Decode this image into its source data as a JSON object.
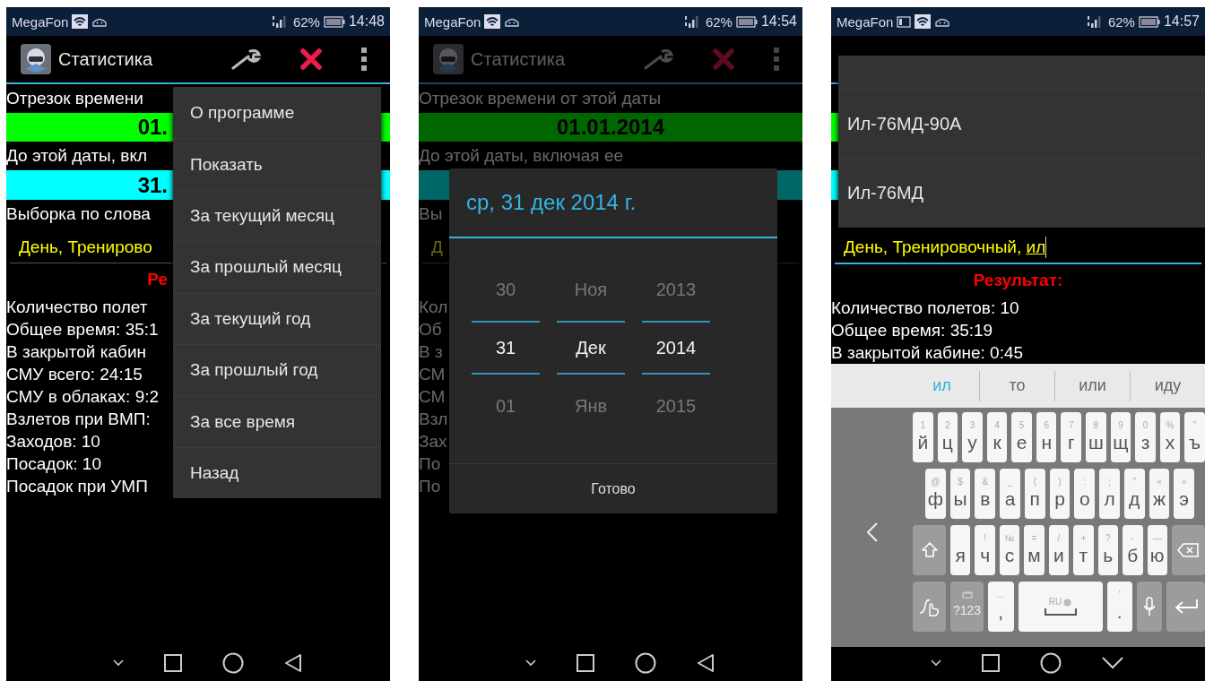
{
  "phones": [
    {
      "kind": "menu",
      "status": {
        "carrier": "MegaFon",
        "screenshot_notice": false,
        "battery": "62%",
        "time": "14:48"
      },
      "app_bar": {
        "title": "Статистика"
      },
      "content": {
        "from_label": "Отрезок времени",
        "from_date": "01.",
        "to_label": "До этой даты, вкл",
        "to_date": "31.",
        "filter_label": "Выборка по слова",
        "filter": {
          "value": "День, Тренирово",
          "focused": false
        },
        "result_title": "Ре",
        "stats": [
          "Количество полет",
          "Общее время: 35:1",
          "В закрытой кабин",
          "СМУ всего: 24:15",
          "СМУ в облаках: 9:2",
          "Взлетов при ВМП:",
          "Заходов: 10",
          "Посадок: 10",
          "Посадок при УМП"
        ]
      },
      "menu": {
        "items": [
          "О программе",
          "Показать",
          "За текущий месяц",
          "За прошлый месяц",
          "За текущий год",
          "За прошлый год",
          "За все время",
          "Назад"
        ]
      }
    },
    {
      "kind": "date_dialog",
      "status": {
        "carrier": "MegaFon",
        "screenshot_notice": false,
        "battery": "62%",
        "time": "14:54"
      },
      "app_bar": {
        "title": "Статистика"
      },
      "content": {
        "from_label": "Отрезок времени от этой даты",
        "from_date": "01.01.2014",
        "to_label": "До этой даты, включая ее",
        "filter_label": "Вы",
        "filter": {
          "value": "Д",
          "focused": false
        },
        "stats": [
          "Кол",
          "Об",
          "В з",
          "СМ",
          "СМ",
          "Взл",
          "Зах",
          "По",
          "По"
        ]
      },
      "dialog": {
        "title": "ср, 31 дек 2014 г.",
        "columns": [
          {
            "items": [
              {
                "text": "30",
                "selected": false
              },
              {
                "text": "31",
                "selected": true
              },
              {
                "text": "01",
                "selected": false
              }
            ]
          },
          {
            "items": [
              {
                "text": "Ноя",
                "selected": false
              },
              {
                "text": "Дек",
                "selected": true
              },
              {
                "text": "Янв",
                "selected": false
              }
            ]
          },
          {
            "items": [
              {
                "text": "2013",
                "selected": false
              },
              {
                "text": "2014",
                "selected": true
              },
              {
                "text": "2015",
                "selected": false
              }
            ]
          }
        ],
        "button": "Готово"
      }
    },
    {
      "kind": "dropdown",
      "status": {
        "carrier": "MegaFon",
        "screenshot_notice": true,
        "battery": "62%",
        "time": "14:57"
      },
      "content": {
        "filter": {
          "value": "День, Тренировочный, ",
          "composing": "ил",
          "focused": true
        },
        "result_title": "Результат:",
        "stats": [
          "Количество полетов: 10",
          "Общее время: 35:19",
          "В закрытой кабине: 0:45"
        ]
      },
      "dropdown": {
        "items": [
          "Ил-76МД-90А",
          "Ил-76МД"
        ]
      },
      "keyboard": {
        "suggestions": [
          {
            "text": "ил",
            "selected": true
          },
          {
            "text": "то",
            "selected": false
          },
          {
            "text": "или",
            "selected": false
          },
          {
            "text": "иду",
            "selected": false
          }
        ],
        "rows": [
          {
            "keys": [
              {
                "kind": "letter",
                "label": "й",
                "hint": "1"
              },
              {
                "kind": "letter",
                "label": "ц",
                "hint": "2"
              },
              {
                "kind": "letter",
                "label": "у",
                "hint": "3"
              },
              {
                "kind": "letter",
                "label": "к",
                "hint": "4"
              },
              {
                "kind": "letter",
                "label": "е",
                "hint": "5"
              },
              {
                "kind": "letter",
                "label": "н",
                "hint": "6"
              },
              {
                "kind": "letter",
                "label": "г",
                "hint": "7"
              },
              {
                "kind": "letter",
                "label": "ш",
                "hint": "8"
              },
              {
                "kind": "letter",
                "label": "щ",
                "hint": "9"
              },
              {
                "kind": "letter",
                "label": "з",
                "hint": "0"
              },
              {
                "kind": "letter",
                "label": "х",
                "hint": "%"
              },
              {
                "kind": "letter",
                "label": "ъ",
                "hint": "\""
              }
            ]
          },
          {
            "keys": [
              {
                "kind": "letter",
                "label": "ф",
                "hint": "@"
              },
              {
                "kind": "letter",
                "label": "ы",
                "hint": "$"
              },
              {
                "kind": "letter",
                "label": "в",
                "hint": "&"
              },
              {
                "kind": "letter",
                "label": "а",
                "hint": "_"
              },
              {
                "kind": "letter",
                "label": "п",
                "hint": "("
              },
              {
                "kind": "letter",
                "label": "р",
                "hint": ")"
              },
              {
                "kind": "letter",
                "label": "о",
                "hint": ":"
              },
              {
                "kind": "letter",
                "label": "л",
                "hint": ";"
              },
              {
                "kind": "letter",
                "label": "д",
                "hint": "\""
              },
              {
                "kind": "letter",
                "label": "ж",
                "hint": "«"
              },
              {
                "kind": "letter",
                "label": "э",
                "hint": "»"
              }
            ]
          },
          {
            "keys": [
              {
                "kind": "shift"
              },
              {
                "kind": "letter",
                "label": "я"
              },
              {
                "kind": "letter",
                "label": "ч",
                "hint": "!"
              },
              {
                "kind": "letter",
                "label": "с",
                "hint": "№"
              },
              {
                "kind": "letter",
                "label": "м",
                "hint": "="
              },
              {
                "kind": "letter",
                "label": "и",
                "hint": "/"
              },
              {
                "kind": "letter",
                "label": "т",
                "hint": "+"
              },
              {
                "kind": "letter",
                "label": "ь",
                "hint": "?"
              },
              {
                "kind": "letter",
                "label": "б",
                "hint": "-"
              },
              {
                "kind": "letter",
                "label": "ю",
                "hint": "—"
              },
              {
                "kind": "backspace"
              }
            ]
          },
          {
            "keys": [
              {
                "kind": "gesture"
              },
              {
                "kind": "symbols",
                "label": "?123"
              },
              {
                "kind": "letter",
                "label": ",",
                "hint": "..."
              },
              {
                "kind": "space",
                "hint": "RU"
              },
              {
                "kind": "letter",
                "label": ".",
                "hint": "'"
              },
              {
                "kind": "mic"
              },
              {
                "kind": "enter"
              }
            ]
          }
        ]
      }
    }
  ]
}
